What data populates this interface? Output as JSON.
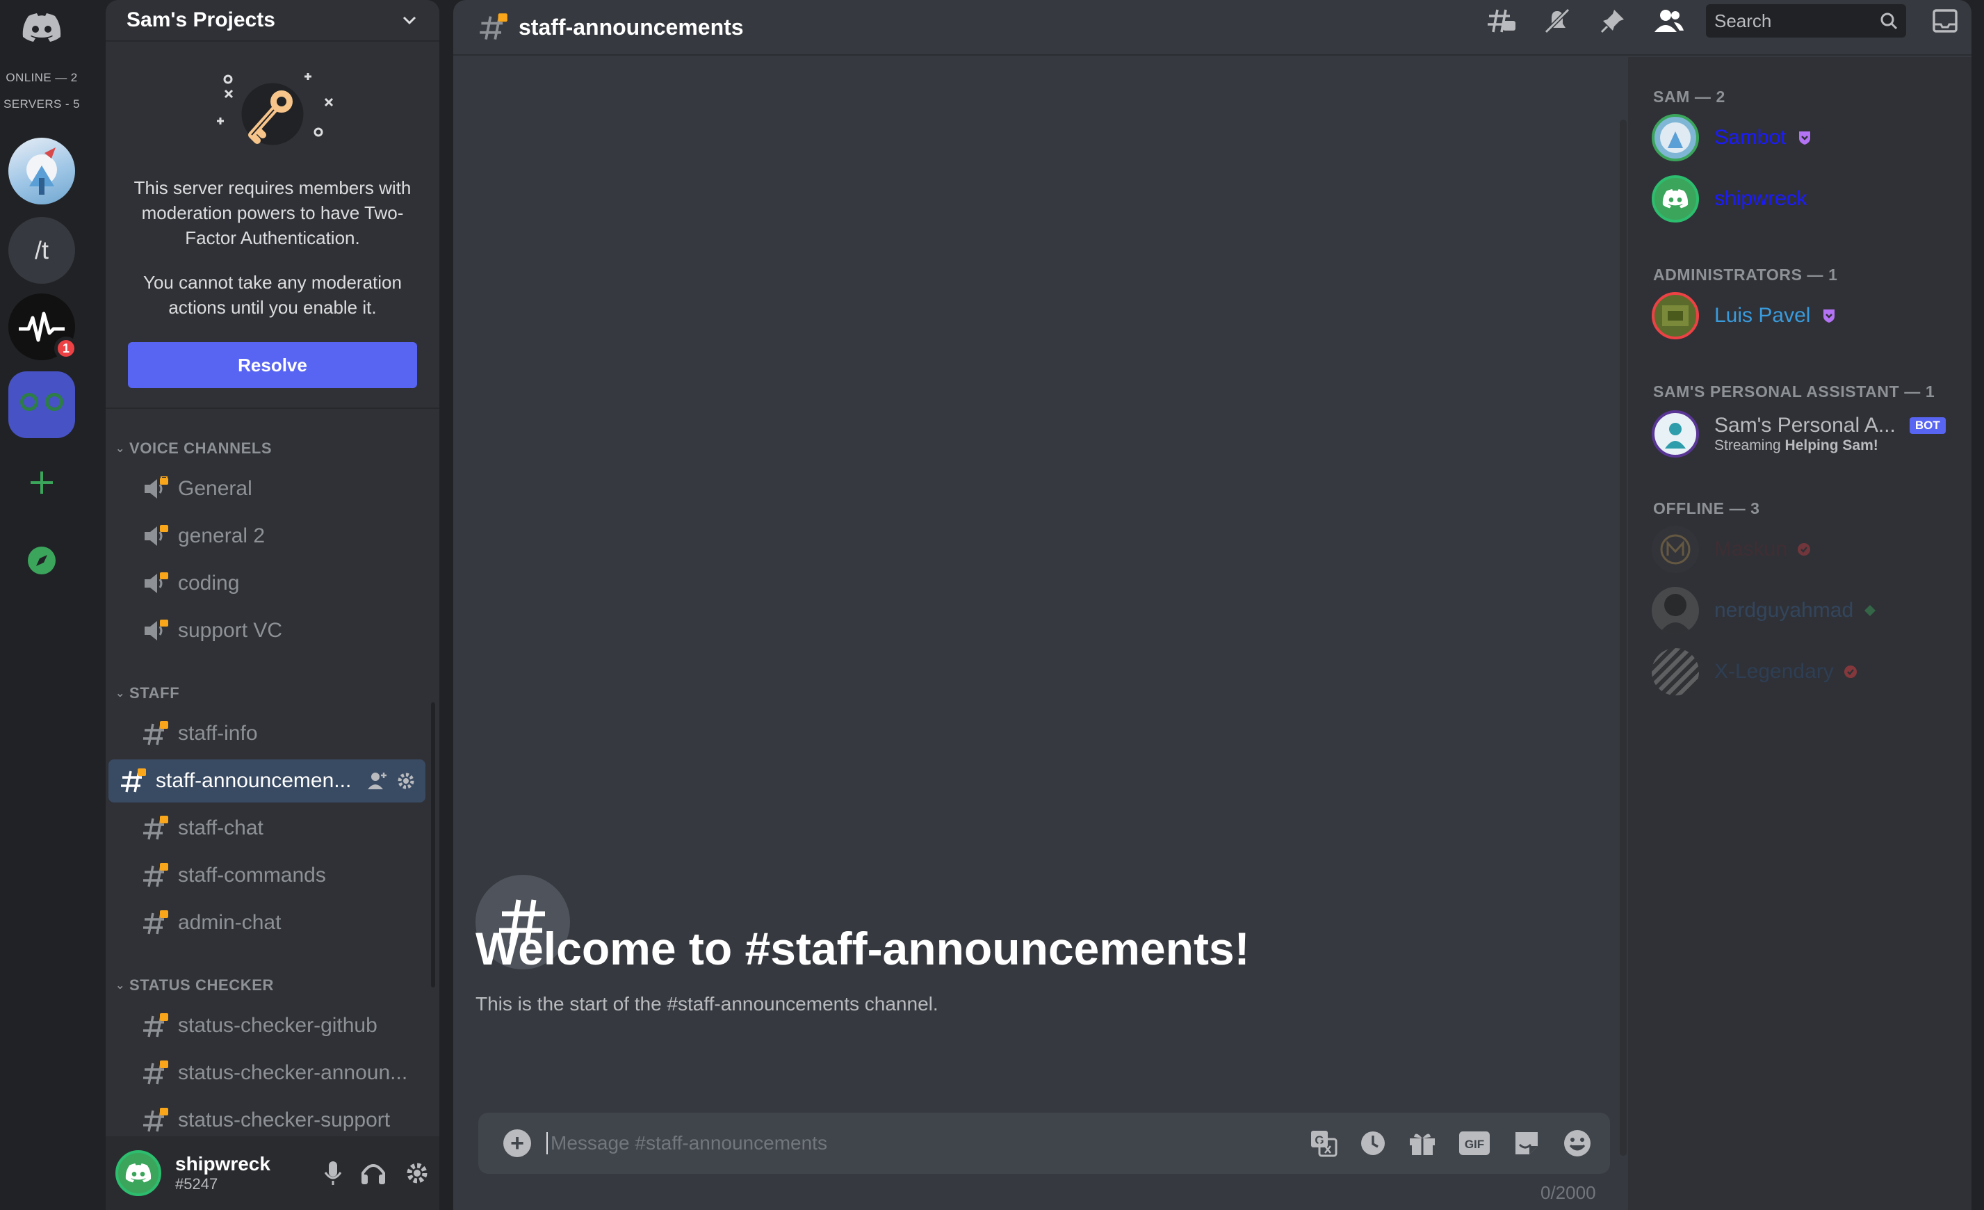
{
  "rail": {
    "online": "ONLINE — 2",
    "servers": "SERVERS - 5",
    "slash_server": "/t",
    "badge_count": "1"
  },
  "server": {
    "name": "Sam's Projects",
    "tfa_text_1": "This server requires members with moderation powers to have Two-Factor Authentication.",
    "tfa_text_2": "You cannot take any moderation actions until you enable it.",
    "resolve_label": "Resolve"
  },
  "categories": {
    "voice": "VOICE CHANNELS",
    "staff": "STAFF",
    "status": "STATUS CHECKER"
  },
  "voice_channels": [
    "General",
    "general 2",
    "coding",
    "support VC"
  ],
  "staff_channels": [
    "staff-info",
    "staff-announcemen...",
    "staff-chat",
    "staff-commands",
    "admin-chat"
  ],
  "status_channels": [
    "status-checker-github",
    "status-checker-announ...",
    "status-checker-support"
  ],
  "user": {
    "name": "shipwreck",
    "tag": "#5247"
  },
  "main": {
    "channel_name": "staff-announcements",
    "search_placeholder": "Search",
    "welcome_title": "Welcome to #staff-announcements!",
    "welcome_sub": "This is the start of the #staff-announcements channel.",
    "message_placeholder": "Message #staff-announcements",
    "char_count": "0/2000",
    "gif_label": "GIF"
  },
  "members": {
    "groups": [
      {
        "title": "SAM — 2"
      },
      {
        "title": "ADMINISTRATORS — 1"
      },
      {
        "title": "SAM'S PERSONAL ASSISTANT — 1"
      },
      {
        "title": "OFFLINE — 3"
      }
    ],
    "list": [
      {
        "name": "Sambot",
        "color": "#1a1aff"
      },
      {
        "name": "shipwreck",
        "color": "#1a1aff"
      },
      {
        "name": "Luis Pavel",
        "color": "#3a9bdc"
      },
      {
        "name": "Sam's Personal A...",
        "color": "#b9bbbe",
        "bot": "BOT",
        "activity_prefix": "Streaming ",
        "activity": "Helping Sam!"
      },
      {
        "name": "Maskun",
        "color": "#5c2a2e"
      },
      {
        "name": "nerdguyahmad",
        "color": "#3a5f8c"
      },
      {
        "name": "X-Legendary",
        "color": "#2d4f7a"
      }
    ]
  },
  "colors": {
    "accent": "#5865f2",
    "active_channel": "#394a63",
    "online_green": "#3ba55c",
    "danger": "#ed4245"
  }
}
